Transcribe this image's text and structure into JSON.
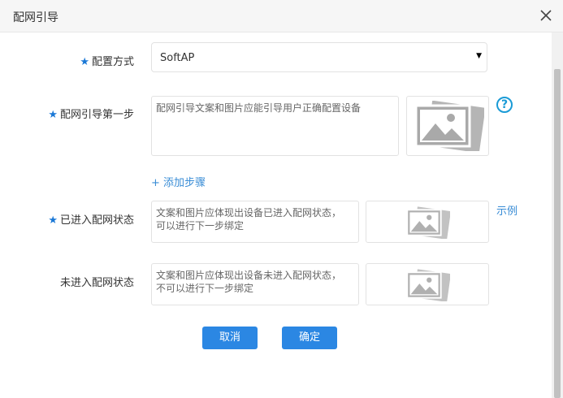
{
  "dialog": {
    "title": "配网引导"
  },
  "form": {
    "config_mode": {
      "label": "配置方式",
      "value": "SoftAP"
    },
    "step1": {
      "label": "配网引导第一步",
      "placeholder": "配网引导文案和图片应能引导用户正确配置设备"
    },
    "add_step": "+ 添加步骤",
    "entered": {
      "label": "已进入配网状态",
      "placeholder_line1": "文案和图片应体现出设备已进入配网状态，",
      "placeholder_line2": "可以进行下一步绑定",
      "example": "示例"
    },
    "not_entered": {
      "label": "未进入配网状态",
      "placeholder_line1": "文案和图片应体现出设备未进入配网状态，",
      "placeholder_line2": "不可以进行下一步绑定"
    }
  },
  "buttons": {
    "cancel": "取消",
    "confirm": "确定"
  },
  "icons": {
    "close": "close-icon",
    "dropdown": "caret-down-icon",
    "help": "question-circle-icon",
    "image_placeholder": "image-icon"
  },
  "colors": {
    "primary": "#2b87e3",
    "required_star": "#1a78d6",
    "link": "#3a8dd6",
    "help": "#1a9bd6"
  }
}
